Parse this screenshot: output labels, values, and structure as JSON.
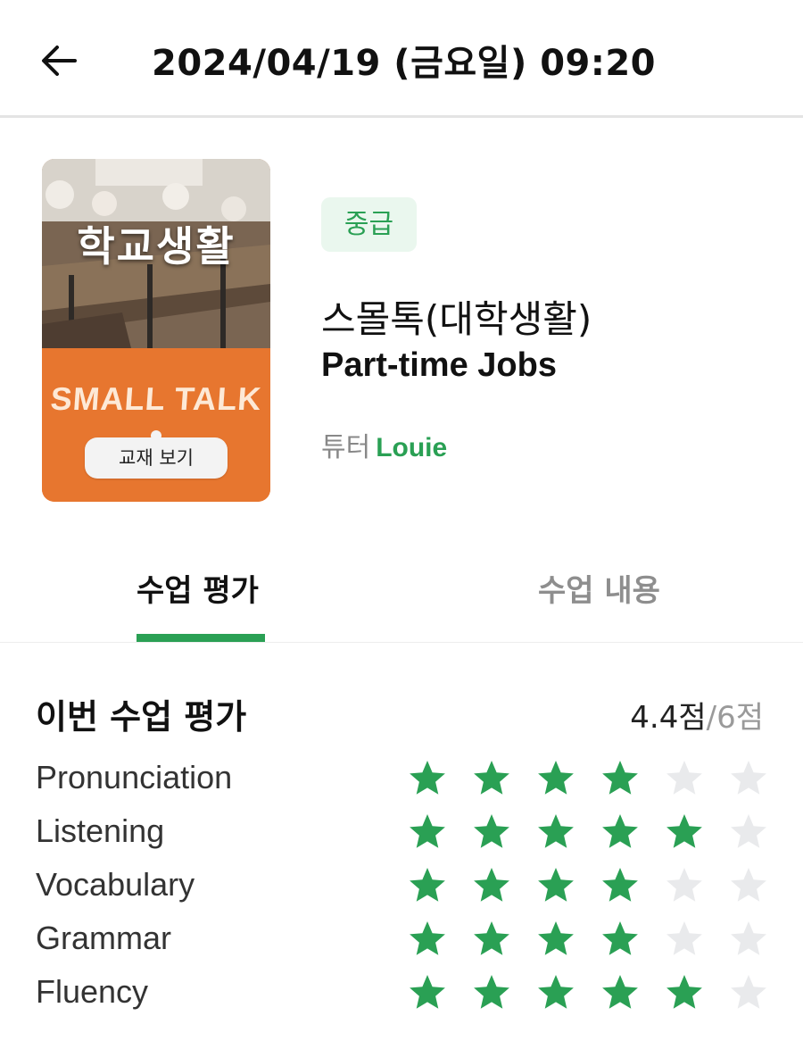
{
  "header": {
    "title": "2024/04/19 (금요일) 09:20"
  },
  "cover": {
    "korean_title": "학교생활",
    "english_title": "SMALL TALK",
    "view_button_label": "교재 보기"
  },
  "course": {
    "level": "중급",
    "title_ko": "스몰톡(대학생활)",
    "title_en": "Part-time Jobs",
    "tutor_label": "튜터",
    "tutor_name": "Louie"
  },
  "tabs": [
    {
      "label": "수업 평가",
      "active": true
    },
    {
      "label": "수업 내용",
      "active": false
    }
  ],
  "evaluation": {
    "section_title": "이번 수업 평가",
    "score": "4.4점",
    "score_max": "/6점",
    "max_stars": 6,
    "ratings": [
      {
        "label": "Pronunciation",
        "stars": 4
      },
      {
        "label": "Listening",
        "stars": 5
      },
      {
        "label": "Vocabulary",
        "stars": 4
      },
      {
        "label": "Grammar",
        "stars": 4
      },
      {
        "label": "Fluency",
        "stars": 5
      }
    ]
  },
  "colors": {
    "accent_green": "#2aa054",
    "star_filled": "#2aa054",
    "star_empty": "#e9eaec",
    "cover_orange": "#e7762f"
  }
}
